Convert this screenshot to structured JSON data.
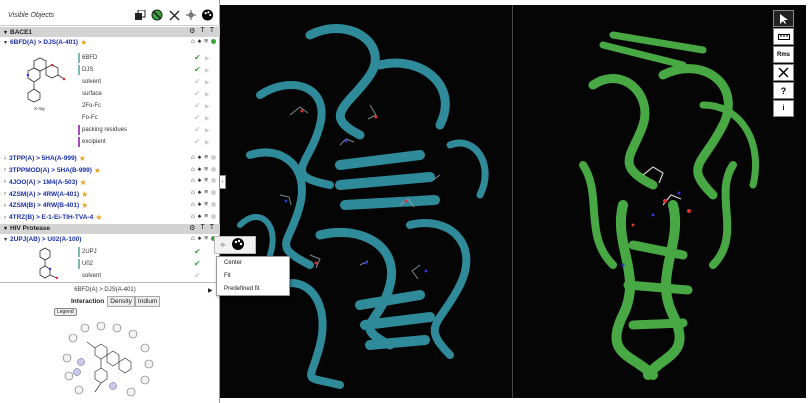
{
  "panel": {
    "title": "Visible Objects",
    "top_icons": [
      "layers-icon",
      "no-symbol-icon",
      "shrink-icon",
      "crosshair-icon",
      "palette-icon"
    ]
  },
  "groups": [
    {
      "name": "BACE1",
      "entries": [
        {
          "label": "6BFD(A) > DJS(A-401)",
          "starred": true,
          "expanded": true,
          "visible": true,
          "children": [
            {
              "label": "6BFD",
              "bar": "#7fb8b0",
              "checked": true
            },
            {
              "label": "DJS",
              "bar": "#7fb8b0",
              "checked": true
            },
            {
              "label": "solvent",
              "bar": "",
              "checked": false
            },
            {
              "label": "surface",
              "bar": "",
              "checked": false
            },
            {
              "label": "2Fo-Fc",
              "bar": "",
              "checked": false
            },
            {
              "label": "Fo-Fc",
              "bar": "",
              "checked": false
            },
            {
              "label": "packing residues",
              "bar": "#a34fc4",
              "checked": false
            },
            {
              "label": "excipient",
              "bar": "#a34fc4",
              "checked": false
            }
          ]
        },
        {
          "label": "3TPP(A) > 5HA(A-999)",
          "starred": true
        },
        {
          "label": "3TPPMOD(A) > 5HA(B-999)",
          "starred": true
        },
        {
          "label": "4JOO(A) > 1M4(A-503)",
          "starred": true
        },
        {
          "label": "4ZSM(A) > 4RW(A-401)",
          "starred": true
        },
        {
          "label": "4ZSM(B) > 4RW(B-401)",
          "starred": true
        },
        {
          "label": "4TRZ(B) > E-1-Ei-TIH-TVA-4",
          "starred": true
        }
      ]
    },
    {
      "name": "HIV Protease",
      "entries": [
        {
          "label": "2UPJ(AB) > U02(A-100)",
          "starred": false,
          "expanded": true,
          "visible": true,
          "children": [
            {
              "label": "2UPJ",
              "bar": "#7fb8b0",
              "checked": true
            },
            {
              "label": "U02",
              "bar": "#7fb8b0",
              "checked": true
            },
            {
              "label": "solvent",
              "bar": "",
              "checked": false
            }
          ]
        }
      ]
    }
  ],
  "structure_caption": "X-ray",
  "context_menu": {
    "items": [
      "Center",
      "Fit",
      "Predefined fit"
    ]
  },
  "interaction_panel": {
    "header": "6BFD(A) > DJS(A-401)",
    "tabs": [
      "Interaction",
      "Density",
      "Iridium"
    ],
    "active_tab": "Interaction",
    "legend_label": "Legend"
  },
  "toolbar": {
    "buttons": [
      "pointer-icon",
      "ruler-icon",
      "Rms",
      "tools-icon",
      "?",
      "i"
    ]
  },
  "colors": {
    "bace1_ribbon": "#2f8a9a",
    "hiv_ribbon": "#47a844",
    "ligand_link": "#1a2fa8",
    "star": "#e5a42a"
  }
}
